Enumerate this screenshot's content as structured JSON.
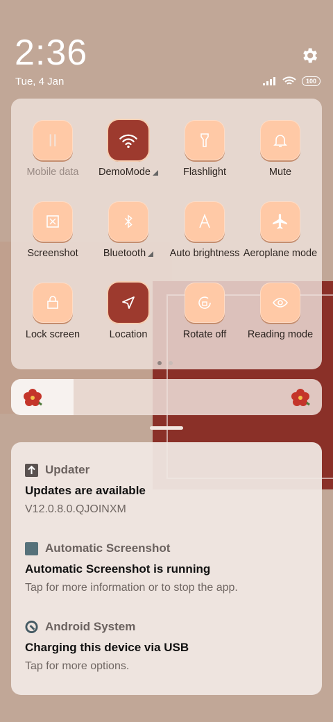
{
  "status": {
    "time": "2:36",
    "date": "Tue, 4 Jan",
    "battery": "100"
  },
  "tiles": [
    {
      "label": "Mobile data",
      "state": "disabled",
      "icon": "mobile-data-icon"
    },
    {
      "label": "DemoMode",
      "state": "on",
      "icon": "wifi-icon",
      "has_menu": true
    },
    {
      "label": "Flashlight",
      "state": "off",
      "icon": "flashlight-icon"
    },
    {
      "label": "Mute",
      "state": "off",
      "icon": "bell-icon"
    },
    {
      "label": "Screenshot",
      "state": "off",
      "icon": "screenshot-icon"
    },
    {
      "label": "Bluetooth",
      "state": "off",
      "icon": "bluetooth-icon",
      "has_menu": true
    },
    {
      "label": "Auto brightness",
      "state": "off",
      "icon": "auto-brightness-icon"
    },
    {
      "label": "Aeroplane mode",
      "state": "off",
      "icon": "aeroplane-icon"
    },
    {
      "label": "Lock screen",
      "state": "off",
      "icon": "lock-icon"
    },
    {
      "label": "Location",
      "state": "on",
      "icon": "location-icon"
    },
    {
      "label": "Rotate off",
      "state": "off",
      "icon": "rotate-icon"
    },
    {
      "label": "Reading mode",
      "state": "off",
      "icon": "eye-icon"
    }
  ],
  "brightness": {
    "level": 0.2
  },
  "notifications": [
    {
      "app": "Updater",
      "title": "Updates are available",
      "text": "V12.0.8.0.QJOINXM",
      "icon": "updater-icon"
    },
    {
      "app": "Automatic Screenshot",
      "title": "Automatic Screenshot is running",
      "text": "Tap for more information or to stop the app.",
      "icon": "automatic-screenshot-icon"
    },
    {
      "app": "Android System",
      "title": "Charging this device via USB",
      "text": "Tap for more options.",
      "icon": "android-system-icon"
    }
  ],
  "colors": {
    "tile_off": "#ffc9a6",
    "tile_on": "#9d3a2e",
    "accent_red": "#8a3028"
  }
}
